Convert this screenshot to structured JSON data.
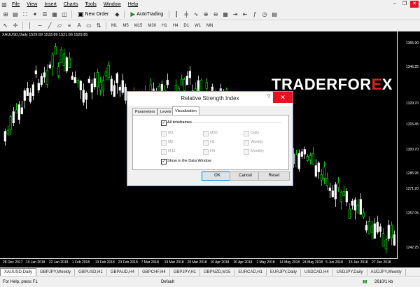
{
  "menu": {
    "items": [
      "File",
      "View",
      "Insert",
      "Charts",
      "Tools",
      "Window",
      "Help"
    ]
  },
  "toolbar1": {
    "new_order_label": "New Order",
    "autotrading_label": "AutoTrading"
  },
  "timeframes": [
    "M1",
    "M5",
    "M15",
    "M30",
    "H1",
    "H4",
    "D1",
    "W1",
    "MN"
  ],
  "chart": {
    "header": "XAUUSD,Daily  1529.69 1533.89 1521.66 1529.85",
    "y_labels": [
      "1365.90",
      "1346.25",
      "1329.70",
      "1315.45",
      "1300.70",
      "1285.95",
      "1271.20",
      "1257.05",
      "1242.25"
    ],
    "x_labels": [
      "28 Dec 2017",
      "10 Jan 2018",
      "22 Jan 2018",
      "1 Feb 2018",
      "13 Feb 2018",
      "23 Feb 2018",
      "7 Mar 2018",
      "19 Mar 2018",
      "29 Mar 2018",
      "10 Apr 2018",
      "20 Apr 2018",
      "2 May 2018",
      "14 May 2018",
      "24 May 2018",
      "5 Jun 2018",
      "15 Jun 2018",
      "27 Jun 2018"
    ],
    "bull_color": "#00ff00",
    "bear_color": "#ffffff",
    "bg_color": "#000000"
  },
  "brand": {
    "text_a": "TRADERFOR",
    "text_x": "E",
    "text_b": "X"
  },
  "dialog": {
    "title": "Relative Strength Index",
    "help": "?",
    "close": "✕",
    "tabs": [
      "Parameters",
      "Levels",
      "Visualization"
    ],
    "active_tab": "Visualization",
    "all_timeframes_label": "All timeframes",
    "timeframes": [
      "M1",
      "M30",
      "Daily",
      "M5",
      "H1",
      "Weekly",
      "M15",
      "H4",
      "Monthly"
    ],
    "show_in_data_window_label": "Show in the Data Window",
    "ok_label": "OK",
    "cancel_label": "Cancel",
    "reset_label": "Reset"
  },
  "tabs": [
    "XAUUSD,Daily",
    "GBPJPY,Weekly",
    "GBPUSD,H1",
    "GBPAUD,H4",
    "GBPCHF,H4",
    "GBPJPY,H1",
    "GBPNZD,M15",
    "EURCAD,H1",
    "EURJPY,Daily",
    "USDCAD,H4",
    "USDJPY,Daily",
    "AUDJPY,Weekly"
  ],
  "status": {
    "help": "For Help, press F1",
    "profile": "Default",
    "traffic": "2610/1 kb"
  }
}
